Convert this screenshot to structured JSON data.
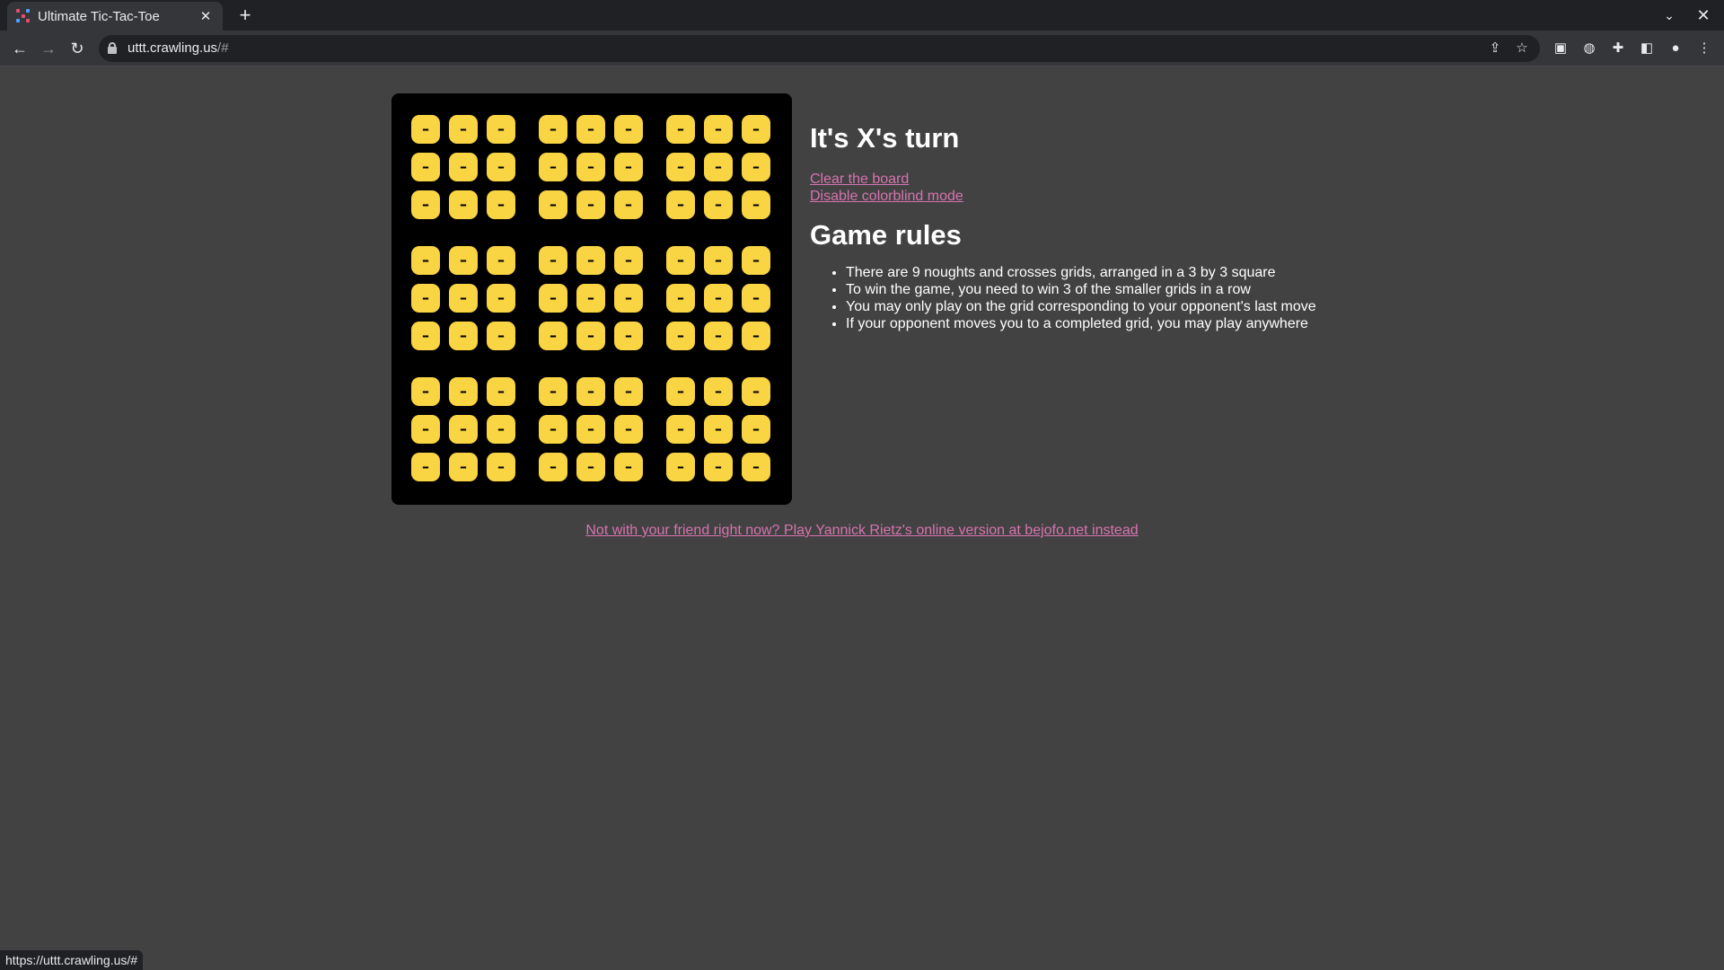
{
  "browser": {
    "tab_title": "Ultimate Tic-Tac-Toe",
    "tab_close": "✕",
    "new_tab": "+",
    "url_host": "uttt.crawling.us",
    "url_path": "/#",
    "status_url": "https://uttt.crawling.us/#"
  },
  "game": {
    "turn_text": "It's X's turn",
    "clear_link": "Clear the board",
    "colorblind_link": "Disable colorblind mode",
    "rules_title": "Game rules",
    "rules": [
      "There are 9 noughts and crosses grids, arranged in a 3 by 3 square",
      "To win the game, you need to win 3 of the smaller grids in a row",
      "You may only play on the grid corresponding to your opponent's last move",
      "If your opponent moves you to a completed grid, you may play anywhere"
    ],
    "footer_link": "Not with your friend right now? Play Yannick Rietz's online version at bejofo.net instead",
    "empty_cell": "–",
    "cell_color": "#f9d443",
    "link_color": "#d674b0"
  }
}
